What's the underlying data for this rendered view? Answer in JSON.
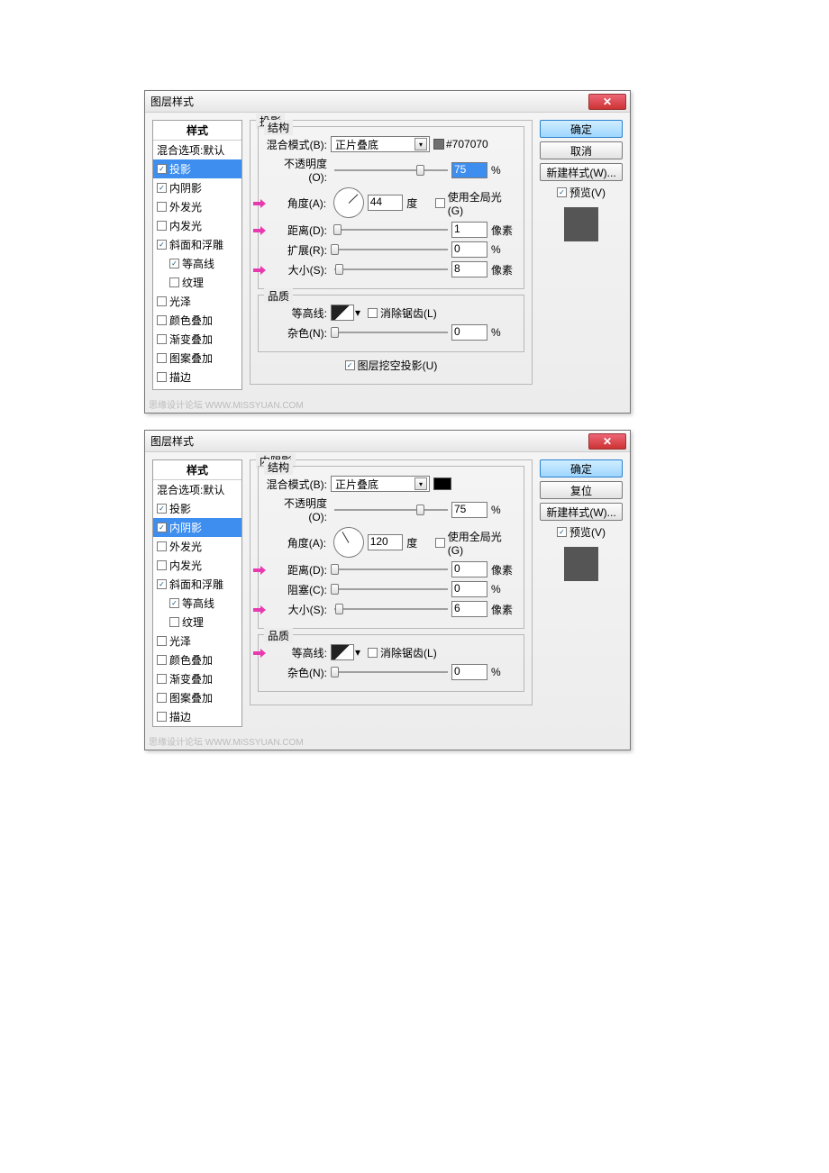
{
  "dialogs": [
    {
      "title": "图层样式",
      "footer": "思缘设计论坛  WWW.MISSYUAN.COM",
      "styles_header": "样式",
      "styles": [
        {
          "label": "混合选项:默认",
          "checked": null
        },
        {
          "label": "投影",
          "checked": true,
          "selected": true
        },
        {
          "label": "内阴影",
          "checked": true
        },
        {
          "label": "外发光",
          "checked": false
        },
        {
          "label": "内发光",
          "checked": false
        },
        {
          "label": "斜面和浮雕",
          "checked": true
        },
        {
          "label": "等高线",
          "checked": true,
          "indent": true
        },
        {
          "label": "纹理",
          "checked": false,
          "indent": true
        },
        {
          "label": "光泽",
          "checked": false
        },
        {
          "label": "颜色叠加",
          "checked": false
        },
        {
          "label": "渐变叠加",
          "checked": false
        },
        {
          "label": "图案叠加",
          "checked": false
        },
        {
          "label": "描边",
          "checked": false
        }
      ],
      "panel_title": "投影",
      "structure_title": "结构",
      "blend_label": "混合模式(B):",
      "blend_value": "正片叠底",
      "color_hint": "#707070",
      "swatch_color": "#707070",
      "opacity_label": "不透明度(O):",
      "opacity_value": "75",
      "opacity_hl": true,
      "opacity_thumb": 75,
      "angle_label": "角度(A):",
      "angle_value": "44",
      "angle_deg": -44,
      "angle_unit": "度",
      "angle_arrow": true,
      "global_label": "使用全局光(G)",
      "global_checked": false,
      "rows": [
        {
          "label": "距离(D):",
          "value": "1",
          "unit": "像素",
          "thumb": 2,
          "arrow": true
        },
        {
          "label": "扩展(R):",
          "value": "0",
          "unit": "%",
          "thumb": 0,
          "arrow": false
        },
        {
          "label": "大小(S):",
          "value": "8",
          "unit": "像素",
          "thumb": 4,
          "arrow": true
        }
      ],
      "quality_title": "品质",
      "contour_label": "等高线:",
      "aa_label": "消除锯齿(L)",
      "aa_checked": false,
      "noise_label": "杂色(N):",
      "noise_value": "0",
      "noise_thumb": 0,
      "knockout_label": "图层挖空投影(U)",
      "knockout_checked": true,
      "buttons": {
        "ok": "确定",
        "cancel": "取消",
        "new": "新建样式(W)...",
        "preview": "预览(V)",
        "preview_checked": true
      },
      "preview_color": "#555555"
    },
    {
      "title": "图层样式",
      "footer": "思缘设计论坛  WWW.MISSYUAN.COM",
      "styles_header": "样式",
      "styles": [
        {
          "label": "混合选项:默认",
          "checked": null
        },
        {
          "label": "投影",
          "checked": true
        },
        {
          "label": "内阴影",
          "checked": true,
          "selected": true
        },
        {
          "label": "外发光",
          "checked": false
        },
        {
          "label": "内发光",
          "checked": false
        },
        {
          "label": "斜面和浮雕",
          "checked": true
        },
        {
          "label": "等高线",
          "checked": true,
          "indent": true
        },
        {
          "label": "纹理",
          "checked": false,
          "indent": true
        },
        {
          "label": "光泽",
          "checked": false
        },
        {
          "label": "颜色叠加",
          "checked": false
        },
        {
          "label": "渐变叠加",
          "checked": false
        },
        {
          "label": "图案叠加",
          "checked": false
        },
        {
          "label": "描边",
          "checked": false
        }
      ],
      "panel_title": "内阴影",
      "structure_title": "结构",
      "blend_label": "混合模式(B):",
      "blend_value": "正片叠底",
      "swatch_color": "#000000",
      "opacity_label": "不透明度(O):",
      "opacity_value": "75",
      "opacity_hl": false,
      "opacity_thumb": 75,
      "angle_label": "角度(A):",
      "angle_value": "120",
      "angle_deg": -120,
      "angle_unit": "度",
      "angle_arrow": false,
      "global_label": "使用全局光(G)",
      "global_checked": false,
      "rows": [
        {
          "label": "距离(D):",
          "value": "0",
          "unit": "像素",
          "thumb": 0,
          "arrow": true
        },
        {
          "label": "阻塞(C):",
          "value": "0",
          "unit": "%",
          "thumb": 0,
          "arrow": false
        },
        {
          "label": "大小(S):",
          "value": "6",
          "unit": "像素",
          "thumb": 4,
          "arrow": true
        }
      ],
      "quality_title": "品质",
      "contour_label": "等高线:",
      "contour_arrow": true,
      "aa_label": "消除锯齿(L)",
      "aa_checked": false,
      "noise_label": "杂色(N):",
      "noise_value": "0",
      "noise_thumb": 0,
      "buttons": {
        "ok": "确定",
        "cancel": "复位",
        "new": "新建样式(W)...",
        "preview": "预览(V)",
        "preview_checked": true
      },
      "preview_color": "#555555"
    }
  ]
}
